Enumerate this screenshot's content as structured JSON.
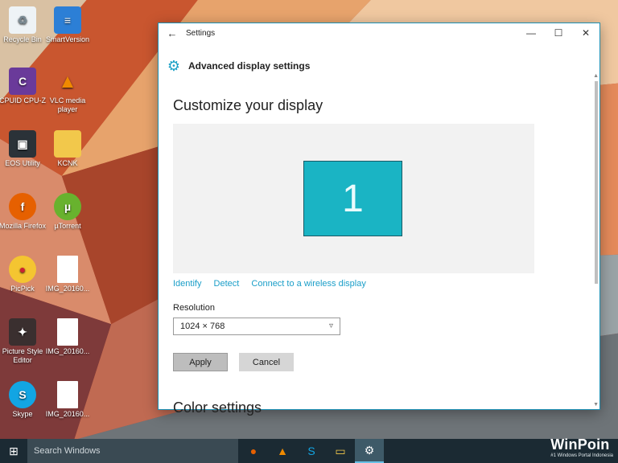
{
  "desktop": {
    "icons": [
      {
        "label": "Recycle Bin",
        "icon": "recycle-bin-icon"
      },
      {
        "label": "SmartVersion",
        "icon": "smartversion-icon"
      },
      {
        "label": "CPUID CPU-Z",
        "icon": "cpu-z-icon"
      },
      {
        "label": "VLC media player",
        "icon": "vlc-icon"
      },
      {
        "label": "EOS Utility",
        "icon": "eos-utility-icon"
      },
      {
        "label": "KCNK",
        "icon": "folder-icon"
      },
      {
        "label": "Mozilla Firefox",
        "icon": "firefox-icon"
      },
      {
        "label": "µTorrent",
        "icon": "utorrent-icon"
      },
      {
        "label": "PicPick",
        "icon": "picpick-icon"
      },
      {
        "label": "IMG_20160...",
        "icon": "file-icon"
      },
      {
        "label": "Picture Style Editor",
        "icon": "picture-style-editor-icon"
      },
      {
        "label": "IMG_20160...",
        "icon": "file-icon"
      },
      {
        "label": "Skype",
        "icon": "skype-icon"
      },
      {
        "label": "IMG_20160...",
        "icon": "file-icon"
      }
    ]
  },
  "window": {
    "title": "Settings",
    "back_icon": "arrow-left-icon",
    "header_title": "Advanced display settings",
    "heading": "Customize your display",
    "monitor_number": "1",
    "links": {
      "identify": "Identify",
      "detect": "Detect",
      "wireless": "Connect to a wireless display"
    },
    "resolution_label": "Resolution",
    "resolution_value": "1024 × 768",
    "apply_label": "Apply",
    "cancel_label": "Cancel",
    "next_heading": "Color settings"
  },
  "taskbar": {
    "search_placeholder": "Search Windows",
    "apps": [
      "firefox-icon",
      "vlc-icon",
      "skype-icon",
      "file-explorer-icon",
      "settings-icon"
    ]
  },
  "watermark": {
    "brand": "WinPoin",
    "tagline": "#1 Windows Portal Indonesia"
  },
  "colors": {
    "accent": "#1a9ec8",
    "monitor": "#1ab4c4",
    "taskbar": "#1b2a33"
  }
}
